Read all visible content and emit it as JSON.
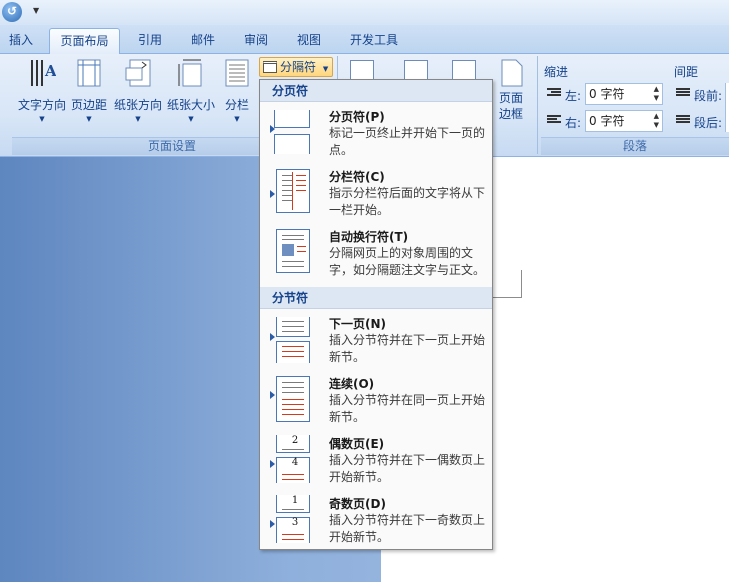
{
  "qat": {
    "icon": "undo-icon",
    "customize_icon": "dropdown-arrow"
  },
  "tabs": [
    "插入",
    "页面布局",
    "引用",
    "邮件",
    "审阅",
    "视图",
    "开发工具"
  ],
  "active_tab": "页面布局",
  "page_setup": {
    "group_label": "页面设置",
    "text_direction": "文字方向",
    "margins": "页边距",
    "orientation": "纸张方向",
    "size": "纸张大小",
    "columns": "分栏",
    "breaks": "分隔符"
  },
  "page_background": {
    "page_borders_line1": "页面",
    "page_borders_line2": "边框"
  },
  "paragraph": {
    "group_label": "段落",
    "indent_title": "缩进",
    "spacing_title": "间距",
    "left_label": "左:",
    "left_value": "0 字符",
    "right_label": "右:",
    "right_value": "0 字符",
    "before_label": "段前:",
    "after_label": "段后:"
  },
  "menu": {
    "page_breaks_header": "分页符",
    "section_breaks_header": "分节符",
    "items": [
      {
        "title": "分页符(P)",
        "desc": "标记一页终止并开始下一页的点。"
      },
      {
        "title": "分栏符(C)",
        "desc": "指示分栏符后面的文字将从下一栏开始。"
      },
      {
        "title": "自动换行符(T)",
        "desc": "分隔网页上的对象周围的文字，如分隔题注文字与正文。"
      },
      {
        "title": "下一页(N)",
        "desc": "插入分节符并在下一页上开始新节。"
      },
      {
        "title": "连续(O)",
        "desc": "插入分节符并在同一页上开始新节。"
      },
      {
        "title": "偶数页(E)",
        "desc": "插入分节符并在下一偶数页上开始新节。",
        "number": "2",
        "number2": "4"
      },
      {
        "title": "奇数页(D)",
        "desc": "插入分节符并在下一奇数页上开始新节。",
        "number": "1",
        "number2": "3"
      }
    ]
  },
  "colors": {
    "ribbon": "#d8e6f7",
    "tab_text": "#15428b",
    "highlight": "#ffd67d",
    "menu_header": "#dde7f3"
  }
}
